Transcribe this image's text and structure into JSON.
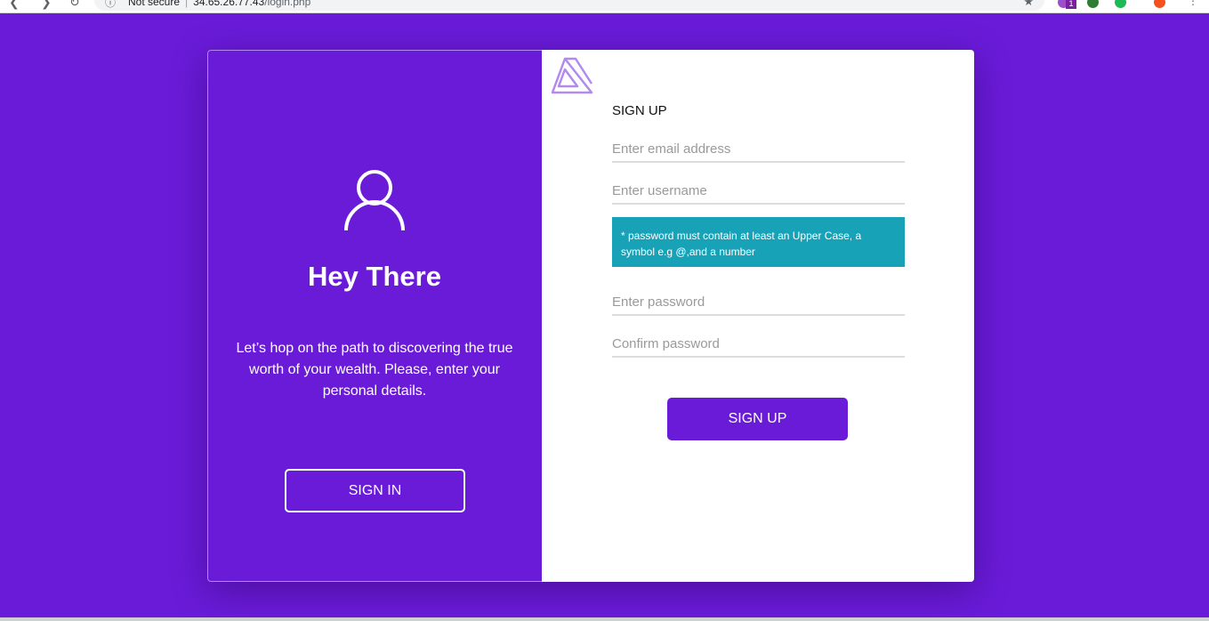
{
  "browser": {
    "security_text": "Not secure",
    "host": "34.65.26.77.43",
    "path": "/login.php",
    "extension_badge": "1"
  },
  "left": {
    "greeting": "Hey There",
    "description": "Let’s hop on the path to discovering the true worth of your wealth. Please, enter your personal details.",
    "signin_label": "SIGN IN"
  },
  "form": {
    "title": "SIGN UP",
    "email_placeholder": "Enter email address",
    "username_placeholder": "Enter username",
    "password_note": "* password must contain at least an Upper Case, a symbol e.g @,and a number",
    "password_placeholder": "Enter password",
    "confirm_placeholder": "Confirm password",
    "submit_label": "SIGN UP"
  },
  "colors": {
    "brand_purple": "#6a1bd8",
    "note_teal": "#17a2b8",
    "logo_lavender": "#b18af0"
  }
}
